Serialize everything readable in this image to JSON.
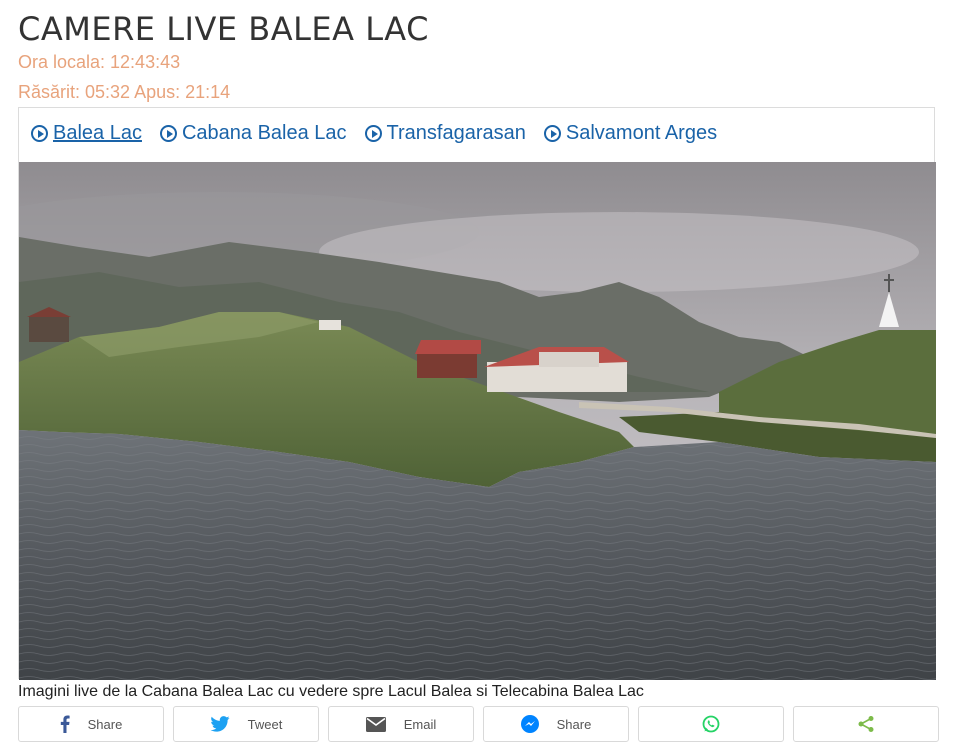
{
  "page": {
    "title": "CAMERE LIVE BALEA LAC",
    "local_time": "Ora locala: 12:43:43",
    "sun_times": "Răsărit: 05:32 Apus: 21:14"
  },
  "camera_tabs": [
    {
      "label": "Balea Lac",
      "active": true,
      "icon": "play-circle-icon"
    },
    {
      "label": "Cabana Balea Lac",
      "active": false,
      "icon": "play-circle-icon"
    },
    {
      "label": "Transfagarasan",
      "active": false,
      "icon": "play-circle-icon"
    },
    {
      "label": "Salvamont Arges",
      "active": false,
      "icon": "play-circle-icon"
    }
  ],
  "caption": "Imagini live de la Cabana Balea Lac cu vedere spre Lacul Balea si Telecabina Balea Lac",
  "share_buttons": [
    {
      "label": "Share",
      "icon": "facebook-icon",
      "color": "#3b5998"
    },
    {
      "label": "Tweet",
      "icon": "twitter-icon",
      "color": "#1da1f2"
    },
    {
      "label": "Email",
      "icon": "email-icon",
      "color": "#555555"
    },
    {
      "label": "Share",
      "icon": "messenger-icon",
      "color": "#0084ff"
    },
    {
      "label": "",
      "icon": "whatsapp-icon",
      "color": "#25d366"
    },
    {
      "label": "",
      "icon": "share-icon",
      "color": "#7dbb4a"
    }
  ],
  "colors": {
    "accent_link": "#1a63a8",
    "time_text": "#e8a37c"
  }
}
